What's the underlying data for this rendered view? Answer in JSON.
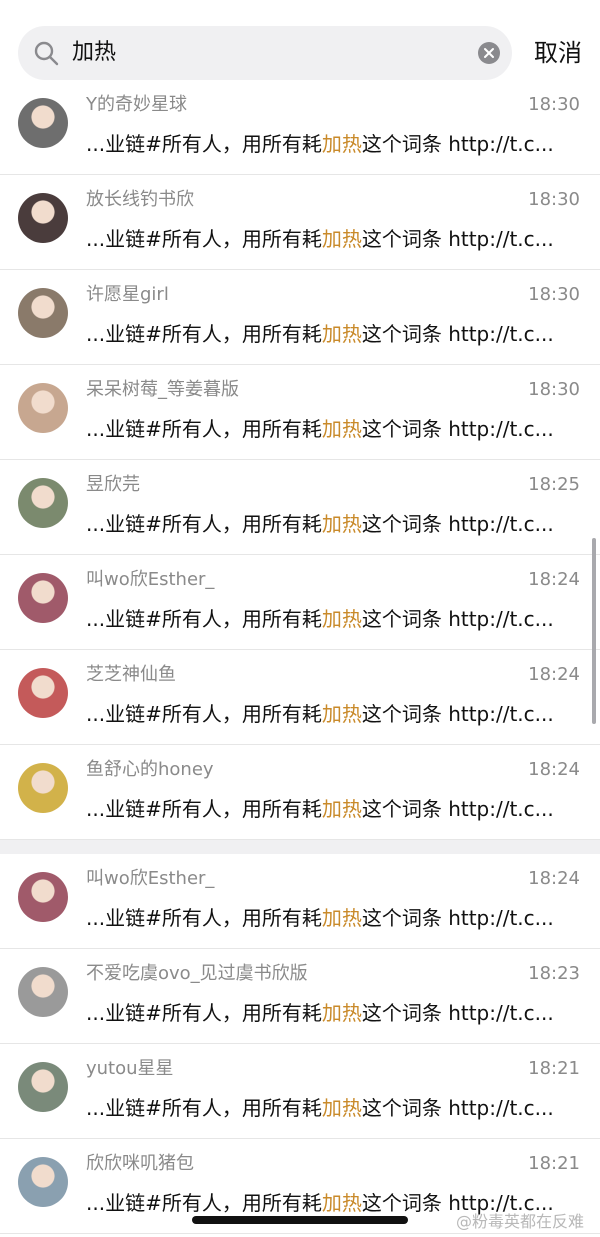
{
  "search": {
    "query": "加热",
    "cancel_label": "取消"
  },
  "snippet": {
    "before": "...业链#所有人，用所有耗",
    "highlight": "加热",
    "after": "这个词条 http://t.c..."
  },
  "highlight_color": "#c98a2a",
  "results": [
    {
      "name": "Y的奇妙星球",
      "time": "18:30",
      "avatar_color": "#6e6e6e"
    },
    {
      "name": "放长线钓书欣",
      "time": "18:30",
      "avatar_color": "#4a3c3c"
    },
    {
      "name": "许愿星girl",
      "time": "18:30",
      "avatar_color": "#8a7a6a"
    },
    {
      "name": "呆呆树莓_等姜暮版",
      "time": "18:30",
      "avatar_color": "#c7a790"
    },
    {
      "name": "昱欣芫",
      "time": "18:25",
      "avatar_color": "#7b8a6e"
    },
    {
      "name": "叫wo欣Esther_",
      "time": "18:24",
      "avatar_color": "#a05a6a"
    },
    {
      "name": "芝芝神仙鱼",
      "time": "18:24",
      "avatar_color": "#c45a5a"
    },
    {
      "name": "鱼舒心的honey",
      "time": "18:24",
      "avatar_color": "#d2b24a"
    },
    {
      "name": "叫wo欣Esther_",
      "time": "18:24",
      "avatar_color": "#a05a6a"
    },
    {
      "name": "不爱吃虞ovo_见过虞书欣版",
      "time": "18:23",
      "avatar_color": "#9a9a9a"
    },
    {
      "name": "yutou星星",
      "time": "18:21",
      "avatar_color": "#7a8a7a"
    },
    {
      "name": "欣欣咪叽猪包",
      "time": "18:21",
      "avatar_color": "#8aa0b0"
    }
  ],
  "watermark": "@粉毒英都在反难"
}
